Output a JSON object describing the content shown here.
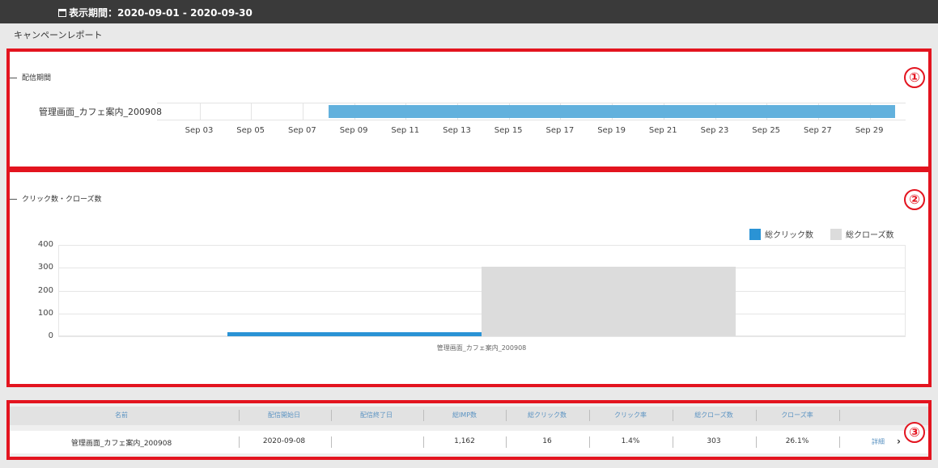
{
  "header": {
    "period_label": "表示期間：2020-09-01 - 2020-09-30"
  },
  "page": {
    "title": "キャンペーンレポート"
  },
  "annotations": [
    "①",
    "②",
    "③"
  ],
  "delivery_section": {
    "title": "配信期間",
    "campaign_name": "管理画面_カフェ案内_200908",
    "date_ticks": [
      "Sep 03",
      "Sep 05",
      "Sep 07",
      "Sep 09",
      "Sep 11",
      "Sep 13",
      "Sep 15",
      "Sep 17",
      "Sep 19",
      "Sep 21",
      "Sep 23",
      "Sep 25",
      "Sep 27",
      "Sep 29"
    ],
    "delivery_start": "2020-09-08",
    "delivery_end": "2020-09-30",
    "bar_color": "#62b1dd"
  },
  "chart_section": {
    "title": "クリック数・クローズ数"
  },
  "chart_data": {
    "type": "bar",
    "categories": [
      "管理画面_カフェ案内_200908"
    ],
    "series": [
      {
        "name": "総クリック数",
        "values": [
          16
        ],
        "color": "#2a93d5"
      },
      {
        "name": "総クローズ数",
        "values": [
          303
        ],
        "color": "#dcdcdc"
      }
    ],
    "yticks": [
      "400",
      "300",
      "200",
      "100",
      "0"
    ],
    "ylim": [
      0,
      400
    ],
    "grid": true,
    "legend": "top-right"
  },
  "table": {
    "headers": [
      "名前",
      "配信開始日",
      "配信終了日",
      "総IMP数",
      "総クリック数",
      "クリック率",
      "総クローズ数",
      "クローズ率"
    ],
    "row": {
      "name": "管理画面_カフェ案内_200908",
      "start_date": "2020-09-08",
      "end_date": "",
      "imp": "1,162",
      "clicks": "16",
      "ctr": "1.4%",
      "closes": "303",
      "close_rate": "26.1%",
      "detail_label": "詳細"
    }
  }
}
